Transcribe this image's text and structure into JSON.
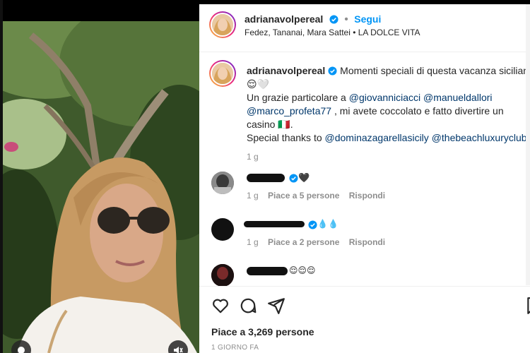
{
  "post": {
    "username": "adrianavolpereal",
    "follow_label": "Segui",
    "separator": "•",
    "audio": "Fedez, Tananai, Mara Sattei • LA DOLCE VITA"
  },
  "caption": {
    "username": "adrianavolpereal",
    "line1_text": "Momenti speciali di questa vacanza siciliana",
    "emojis": "😌🤍",
    "line2_text": "Un grazie particolare a ",
    "mention1": "@giovanniciacci",
    "mention2": "@manueldallori",
    "mention3": "@marco_profeta77",
    "line3_text": " , mi avete coccolato e fatto divertire un casino ",
    "line3_end": "🇮🇹.",
    "line4_text": "Special thanks to ",
    "mention4": "@dominazagarellasicily",
    "mention5": "@thebeachluxuryclub",
    "time": "1 g"
  },
  "comments": [
    {
      "suffix": "🖤",
      "time": "1 g",
      "likes": "Piace a 5 persone",
      "reply": "Rispondi"
    },
    {
      "suffix": "💧💧",
      "time": "1 g",
      "likes": "Piace a 2 persone",
      "reply": "Rispondi"
    },
    {
      "suffix": "😌😌😌"
    }
  ],
  "actions": {
    "likes_count": "Piace a 3,269 persone",
    "posted": "1 GIORNO FA"
  },
  "colors": {
    "link": "#00376b",
    "accent": "#0095f6",
    "muted": "#8e8e8e",
    "verified": "#0095f6"
  }
}
